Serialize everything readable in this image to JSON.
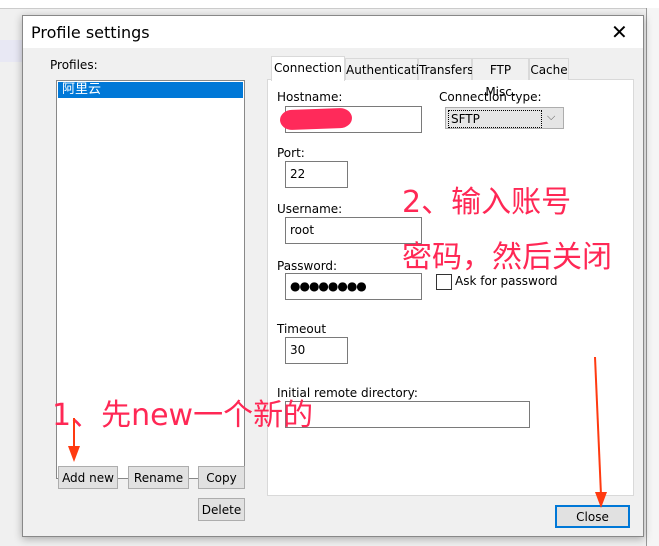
{
  "dialog": {
    "title": "Profile settings",
    "close_icon": "close-icon"
  },
  "profiles": {
    "label": "Profiles:",
    "items": [
      "阿里云"
    ],
    "selected": 0
  },
  "buttons": {
    "add_new": "Add new",
    "rename": "Rename",
    "copy": "Copy",
    "delete": "Delete",
    "close": "Close"
  },
  "tabs": [
    "Connection",
    "Authentication",
    "Transfers",
    "FTP Misc.",
    "Cache"
  ],
  "active_tab": "Connection",
  "form": {
    "hostname_label": "Hostname:",
    "connection_type_label": "Connection type:",
    "connection_type_value": "SFTP",
    "port_label": "Port:",
    "port_value": "22",
    "username_label": "Username:",
    "username_value": "root",
    "password_label": "Password:",
    "password_value": "●●●●●●●●",
    "ask_password_label": "Ask for password",
    "ask_password_checked": false,
    "timeout_label": "Timeout",
    "timeout_value": "30",
    "initial_dir_label": "Initial remote directory:",
    "initial_dir_value": ""
  },
  "annotations": {
    "step1": "1、先new一个新的",
    "step2_line1": "2、输入账号",
    "step2_line2": "密码，然后关闭"
  },
  "colors": {
    "accent": "#0078d7",
    "annotation": "#ff2855",
    "arrow": "#ff3a10"
  }
}
